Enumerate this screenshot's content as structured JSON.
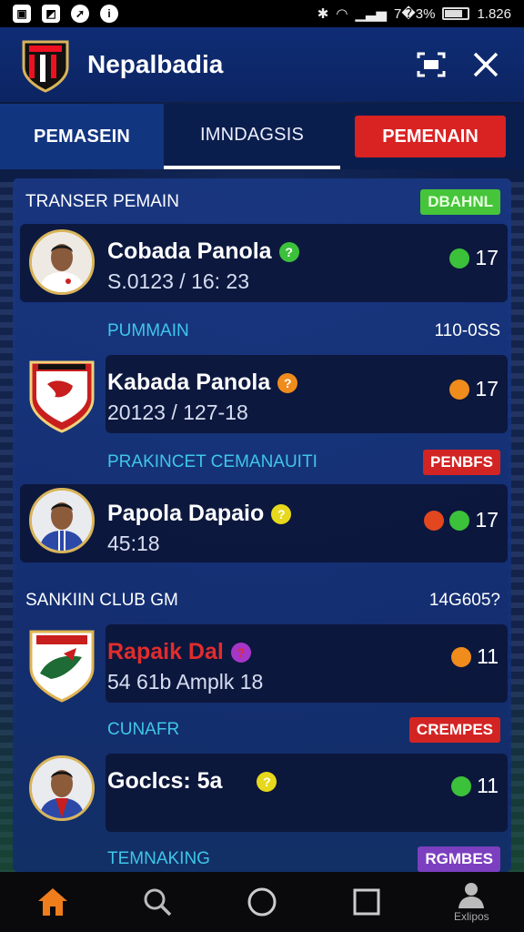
{
  "status_bar": {
    "signal_text": "%",
    "battery_pct": "7�3%",
    "time": "1.826"
  },
  "header": {
    "title": "Nepalbadia"
  },
  "tabs": [
    {
      "label": "PEMASEIN"
    },
    {
      "label": "IMNDAGSIS"
    },
    {
      "label": "PEMENAIN"
    }
  ],
  "sections": {
    "s1": {
      "title": "TRANSER PEMAIN",
      "tag": "DBAHNL"
    },
    "s2": {
      "title": "PUMMAIN",
      "right": "110-0SS"
    },
    "s3": {
      "title": "PRAKINCET  CEMANAUITI",
      "tag": "PENBFS"
    },
    "s4": {
      "title": "SANKIIN CLUB GM",
      "right": "14G605?"
    },
    "s5": {
      "title": "CUNAFR",
      "tag": "CREMPES"
    },
    "s6": {
      "title": "TEMNAKING",
      "tag": "RGMBES"
    }
  },
  "players": [
    {
      "name": "Cobada Panola",
      "sub": "S.0123 / 16: 23",
      "count": "17"
    },
    {
      "name": "Kabada Panola",
      "sub": "20123 / 127-18",
      "count": "17"
    },
    {
      "name": "Papola Dapaio",
      "sub": "45:18",
      "count": "17"
    },
    {
      "name": "Rapaik Dal",
      "sub": "54 61b Amplk 18",
      "count": "11"
    },
    {
      "name": "Goclcs: 5a",
      "sub": "",
      "count": "11"
    }
  ],
  "question_mark": "?",
  "nav": {
    "profile_label": "Exlipos"
  },
  "colors": {
    "accent_red": "#d92222",
    "tab_active": "#123580",
    "tag_green": "#46c53a",
    "tag_purple": "#7b3fbf"
  }
}
